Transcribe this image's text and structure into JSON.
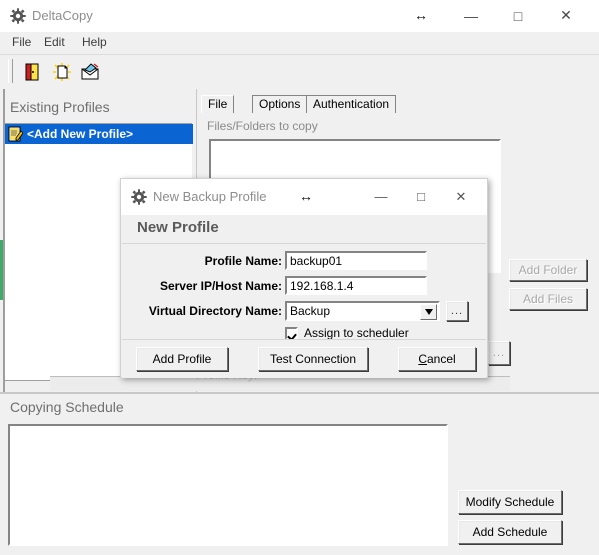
{
  "window": {
    "title": "DeltaCopy",
    "icon": "gear-icon",
    "minimize": "—",
    "maximize": "□",
    "close": "✕",
    "resize_cursor": "↔"
  },
  "menu": {
    "items": [
      "File",
      "Edit",
      "Help"
    ]
  },
  "toolbar": {
    "icons": [
      "exit-door-icon",
      "new-document-icon",
      "email-envelope-icon"
    ]
  },
  "left_panel": {
    "heading": "Existing Profiles",
    "items": [
      {
        "label": "<Add New Profile>",
        "icon": "notepad-pencil-icon",
        "selected": true
      }
    ]
  },
  "right_panel": {
    "tabs": [
      {
        "label": "File List",
        "active": true
      },
      {
        "label": "Options",
        "active": false
      },
      {
        "label": "Authentication",
        "active": false
      }
    ],
    "file_list_caption": "Files/Folders to copy",
    "file_list_items": [],
    "buttons": [
      {
        "label": "Add Folder",
        "enabled": false
      },
      {
        "label": "Add Files",
        "enabled": false
      }
    ],
    "profile_key_caption": "Profile Key:",
    "browse_button": "..."
  },
  "schedule": {
    "heading": "Copying Schedule",
    "items": [],
    "buttons": [
      {
        "label": "Modify Schedule"
      },
      {
        "label": "Add Schedule"
      }
    ]
  },
  "dialog": {
    "title": "New Backup Profile",
    "icon": "gear-icon",
    "heading": "New Profile",
    "minimize": "—",
    "maximize": "□",
    "close": "✕",
    "resize_cursor": "↔",
    "fields": {
      "profile_name": {
        "label": "Profile Name:",
        "value": "backup01"
      },
      "server_host": {
        "label": "Server IP/Host Name:",
        "value": "192.168.1.4"
      },
      "virtual_directory": {
        "label": "Virtual Directory Name:",
        "value": "Backup",
        "options": [
          "Backup"
        ],
        "arrow": "▼",
        "browse": "..."
      },
      "assign_scheduler": {
        "label": "Assign to scheduler",
        "checked": true
      }
    },
    "buttons": {
      "add_profile": "Add Profile",
      "test_connection": "Test Connection",
      "cancel_prefix": "C",
      "cancel_suffix": "ancel"
    }
  },
  "colors": {
    "selection_blue": "#0a64d2",
    "face": "#f0f0f0",
    "accent_green": "#3faa6a",
    "disabled_text": "#a8a8a8"
  }
}
